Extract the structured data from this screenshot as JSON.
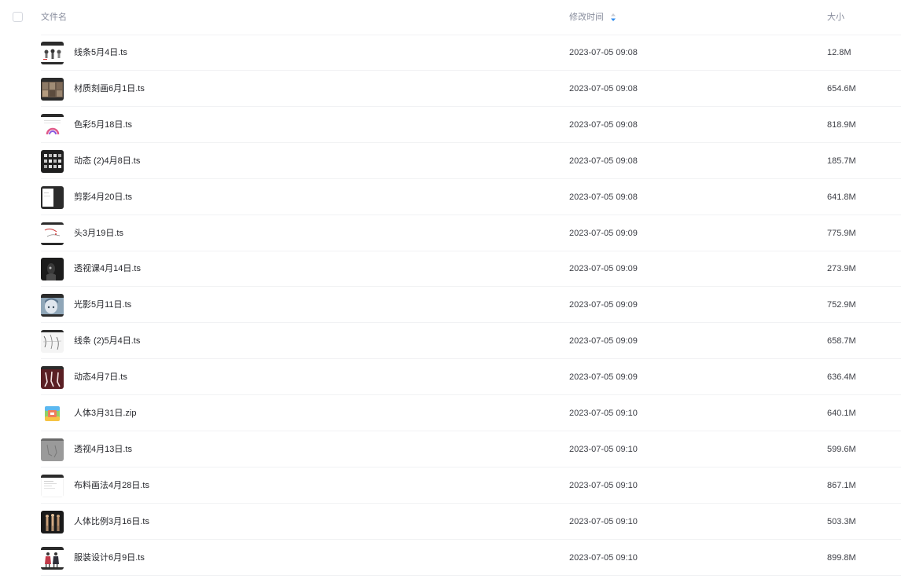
{
  "header": {
    "name_label": "文件名",
    "time_label": "修改时间",
    "size_label": "大小",
    "sort_color": "#2f8cf0"
  },
  "files": [
    {
      "name": "线条5月4日.ts",
      "time": "2023-07-05 09:08",
      "size": "12.8M",
      "thumb": "video-thumb-figures"
    },
    {
      "name": "材质刻画6月1日.ts",
      "time": "2023-07-05 09:08",
      "size": "654.6M",
      "thumb": "video-thumb-photo-grid"
    },
    {
      "name": "色彩5月18日.ts",
      "time": "2023-07-05 09:08",
      "size": "818.9M",
      "thumb": "video-thumb-color-wheel"
    },
    {
      "name": "动态 (2)4月8日.ts",
      "time": "2023-07-05 09:08",
      "size": "185.7M",
      "thumb": "video-thumb-dark-grid"
    },
    {
      "name": "剪影4月20日.ts",
      "time": "2023-07-05 09:08",
      "size": "641.8M",
      "thumb": "video-thumb-silhouette"
    },
    {
      "name": "头3月19日.ts",
      "time": "2023-07-05 09:09",
      "size": "775.9M",
      "thumb": "video-thumb-head-sketch"
    },
    {
      "name": "透视课4月14日.ts",
      "time": "2023-07-05 09:09",
      "size": "273.9M",
      "thumb": "video-thumb-dark-figure"
    },
    {
      "name": "光影5月11日.ts",
      "time": "2023-07-05 09:09",
      "size": "752.9M",
      "thumb": "video-thumb-anime-face"
    },
    {
      "name": "线条 (2)5月4日.ts",
      "time": "2023-07-05 09:09",
      "size": "658.7M",
      "thumb": "video-thumb-line-sketch"
    },
    {
      "name": "动态4月7日.ts",
      "time": "2023-07-05 09:09",
      "size": "636.4M",
      "thumb": "video-thumb-red-figures"
    },
    {
      "name": "人体3月31日.zip",
      "time": "2023-07-05 09:10",
      "size": "640.1M",
      "thumb": "zip-archive-icon"
    },
    {
      "name": "透视4月13日.ts",
      "time": "2023-07-05 09:10",
      "size": "599.6M",
      "thumb": "video-thumb-gray-sketch"
    },
    {
      "name": "布料画法4月28日.ts",
      "time": "2023-07-05 09:10",
      "size": "867.1M",
      "thumb": "video-thumb-document"
    },
    {
      "name": "人体比例3月16日.ts",
      "time": "2023-07-05 09:10",
      "size": "503.3M",
      "thumb": "video-thumb-anatomy"
    },
    {
      "name": "服装设计6月9日.ts",
      "time": "2023-07-05 09:10",
      "size": "899.8M",
      "thumb": "video-thumb-costume"
    }
  ]
}
